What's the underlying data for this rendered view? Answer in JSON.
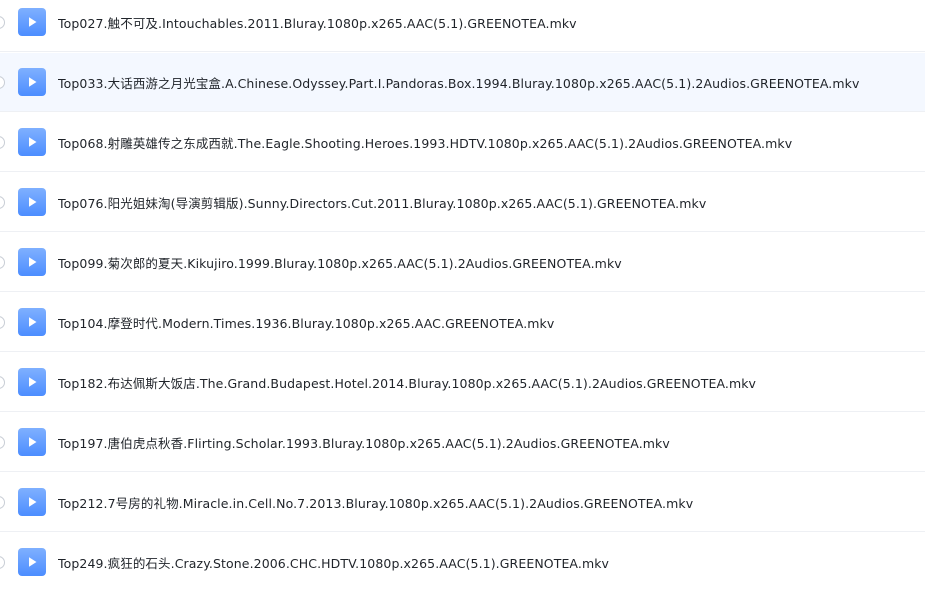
{
  "file_list": {
    "icon": "play-video-icon",
    "accent_color": "#4c8dff",
    "highlight_color": "#f4f8ff",
    "items": [
      {
        "name": "Top027.触不可及.Intouchables.2011.Bluray.1080p.x265.AAC(5.1).GREENOTEA.mkv",
        "highlighted": false
      },
      {
        "name": "Top033.大话西游之月光宝盒.A.Chinese.Odyssey.Part.I.Pandoras.Box.1994.Bluray.1080p.x265.AAC(5.1).2Audios.GREENOTEA.mkv",
        "highlighted": true
      },
      {
        "name": "Top068.射雕英雄传之东成西就.The.Eagle.Shooting.Heroes.1993.HDTV.1080p.x265.AAC(5.1).2Audios.GREENOTEA.mkv",
        "highlighted": false
      },
      {
        "name": "Top076.阳光姐妹淘(导演剪辑版).Sunny.Directors.Cut.2011.Bluray.1080p.x265.AAC(5.1).GREENOTEA.mkv",
        "highlighted": false
      },
      {
        "name": "Top099.菊次郎的夏天.Kikujiro.1999.Bluray.1080p.x265.AAC(5.1).2Audios.GREENOTEA.mkv",
        "highlighted": false
      },
      {
        "name": "Top104.摩登时代.Modern.Times.1936.Bluray.1080p.x265.AAC.GREENOTEA.mkv",
        "highlighted": false
      },
      {
        "name": "Top182.布达佩斯大饭店.The.Grand.Budapest.Hotel.2014.Bluray.1080p.x265.AAC(5.1).2Audios.GREENOTEA.mkv",
        "highlighted": false
      },
      {
        "name": "Top197.唐伯虎点秋香.Flirting.Scholar.1993.Bluray.1080p.x265.AAC(5.1).2Audios.GREENOTEA.mkv",
        "highlighted": false
      },
      {
        "name": "Top212.7号房的礼物.Miracle.in.Cell.No.7.2013.Bluray.1080p.x265.AAC(5.1).2Audios.GREENOTEA.mkv",
        "highlighted": false
      },
      {
        "name": "Top249.疯狂的石头.Crazy.Stone.2006.CHC.HDTV.1080p.x265.AAC(5.1).GREENOTEA.mkv",
        "highlighted": false
      }
    ]
  }
}
